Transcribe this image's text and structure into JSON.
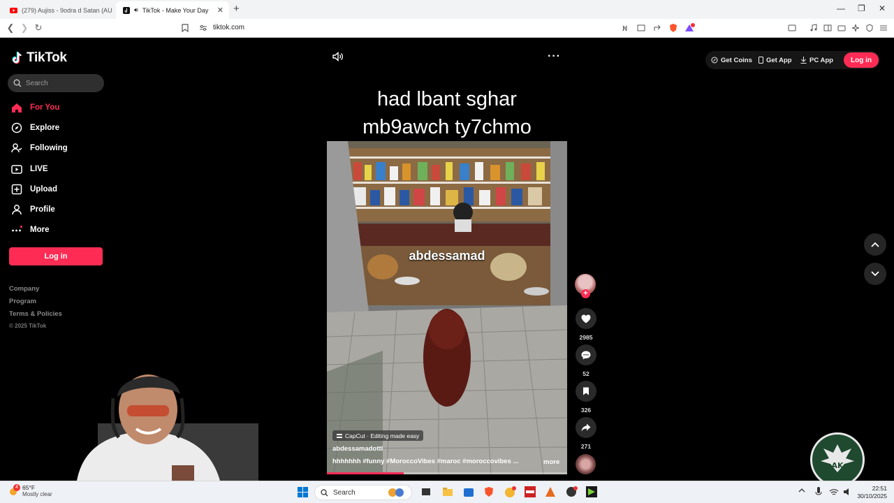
{
  "browser": {
    "tabs": [
      {
        "title": "(279) Aujiss - 9odra d Satan (AUJ TH",
        "active": false
      },
      {
        "title": "TikTok - Make Your Day",
        "active": true
      }
    ],
    "url": "tiktok.com"
  },
  "sidebar": {
    "logo_text": "TikTok",
    "search_placeholder": "Search",
    "nav": [
      {
        "label": "For You",
        "icon": "home-icon",
        "active": true
      },
      {
        "label": "Explore",
        "icon": "compass-icon"
      },
      {
        "label": "Following",
        "icon": "following-icon"
      },
      {
        "label": "LIVE",
        "icon": "live-icon"
      },
      {
        "label": "Upload",
        "icon": "upload-icon"
      },
      {
        "label": "Profile",
        "icon": "profile-icon"
      },
      {
        "label": "More",
        "icon": "more-icon"
      }
    ],
    "login_label": "Log in",
    "footer_links": [
      "Company",
      "Program",
      "Terms & Policies"
    ],
    "copyright": "© 2025 TikTok"
  },
  "video": {
    "caption_line1": "had lbant sghar",
    "caption_line2": "mb9awch ty7chmo",
    "overlay_name": "abdessamad",
    "capcut_label": "CapCut · Editing made easy",
    "author": "abdessamadottl",
    "hashtags": "hhhhhhh #funny  #MoroccoVibes  #maroc  #moroccovibes  ...",
    "more_label": "more",
    "progress": 0.32
  },
  "actions": {
    "likes": "2985",
    "comments": "52",
    "saves": "326",
    "shares": "271"
  },
  "topright": {
    "get_coins": "Get Coins",
    "get_app": "Get App",
    "pc_app": "PC App",
    "login": "Log in"
  },
  "taskbar": {
    "temp": "65°F",
    "weather": "Mostly clear",
    "search_label": "Search",
    "time": "22:51",
    "date": "30/10/2025",
    "notification_count": "4"
  },
  "colors": {
    "accent": "#fe2c55",
    "background": "#000000"
  }
}
